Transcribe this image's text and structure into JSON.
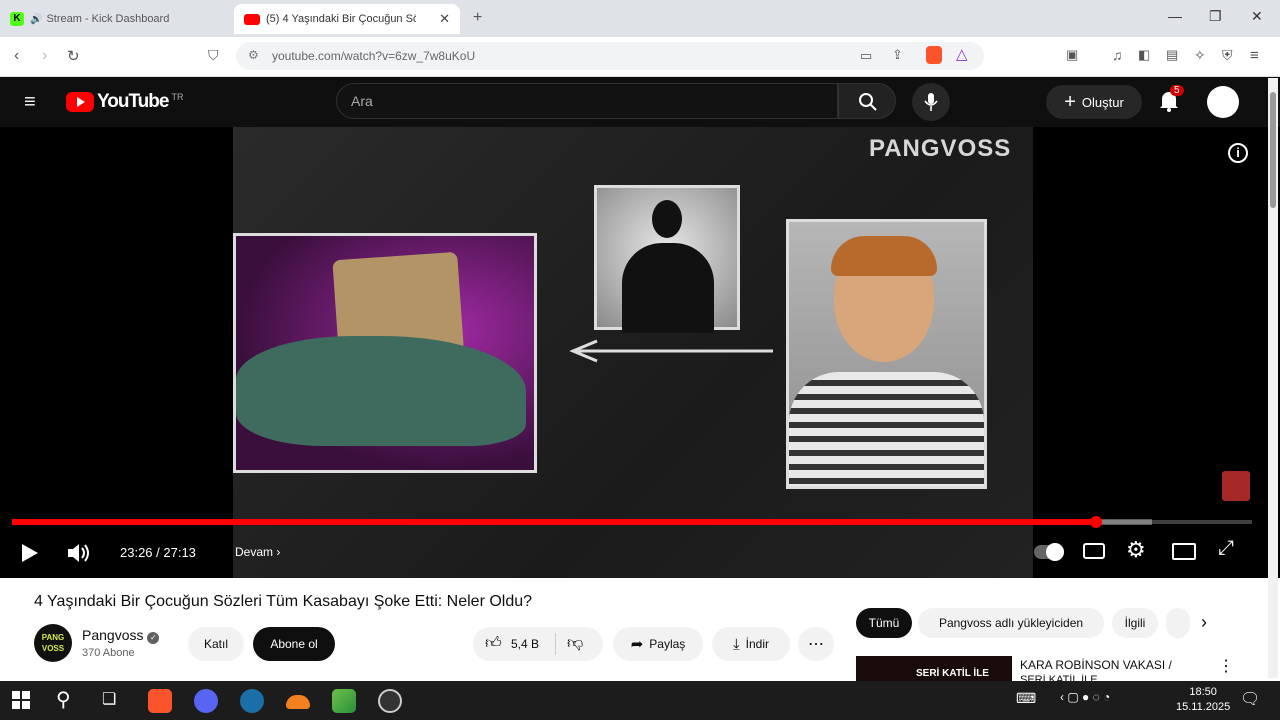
{
  "browser": {
    "tabs": [
      {
        "label": "Stream - Kick Dashboard",
        "favicon_color": "#53fc18"
      },
      {
        "label": "(5) 4 Yaşındaki Bir Çocuğun Söz",
        "favicon_color": "#ff0000"
      }
    ],
    "url": "youtube.com/watch?v=6zw_7w8uKoU"
  },
  "youtube": {
    "logo": "YouTube",
    "region": "TR",
    "search_placeholder": "Ara",
    "create_label": "Oluştur",
    "notification_count": "5"
  },
  "video": {
    "watermark": "PANGVOSS",
    "time": "23:26 / 27:13",
    "progress": 0.874,
    "continue_label": "Devam"
  },
  "details": {
    "title": "4 Yaşındaki Bir Çocuğun Sözleri Tüm Kasabayı Şoke Etti: Neler Oldu?",
    "channel": "Pangvoss",
    "subscribers": "370 Abone",
    "join_label": "Katıl",
    "subscribe_label": "Abone ol",
    "likes": "5,4 B",
    "share_label": "Paylaş",
    "download_label": "İndir",
    "avatar_text_1": "PANG",
    "avatar_text_2": "VOSS"
  },
  "chips": [
    "Tümü",
    "Pangvoss adlı yükleyiciden",
    "İlgili"
  ],
  "recommendation": {
    "title": "KARA ROBİNSON VAKASI /",
    "subtitle": "SERİ KATİL İLE",
    "thumb_text": "SERİ KATİL İLE"
  },
  "taskbar": {
    "time": "18:50",
    "date": "15.11.2025"
  }
}
